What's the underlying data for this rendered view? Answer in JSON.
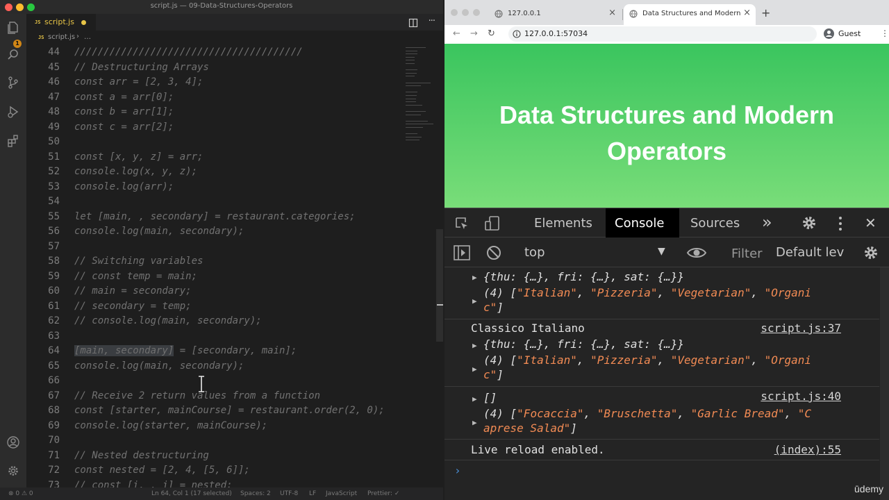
{
  "vscode": {
    "window_title": "script.js — 09-Data-Structures-Operators",
    "tab_label": "script.js",
    "file_badge": "JS",
    "breadcrumb_file": "script.js",
    "breadcrumb_sep": "›",
    "breadcrumb_more": "…",
    "source_control_badge": "1",
    "more_actions": "···",
    "lines": [
      {
        "n": "44",
        "code": "///////////////////////////////////////"
      },
      {
        "n": "45",
        "code": "// Destructuring Arrays"
      },
      {
        "n": "46",
        "code": "const arr = [2, 3, 4];"
      },
      {
        "n": "47",
        "code": "const a = arr[0];"
      },
      {
        "n": "48",
        "code": "const b = arr[1];"
      },
      {
        "n": "49",
        "code": "const c = arr[2];"
      },
      {
        "n": "50",
        "code": ""
      },
      {
        "n": "51",
        "code": "const [x, y, z] = arr;"
      },
      {
        "n": "52",
        "code": "console.log(x, y, z);"
      },
      {
        "n": "53",
        "code": "console.log(arr);"
      },
      {
        "n": "54",
        "code": ""
      },
      {
        "n": "55",
        "code": "let [main, , secondary] = restaurant.categories;"
      },
      {
        "n": "56",
        "code": "console.log(main, secondary);"
      },
      {
        "n": "57",
        "code": ""
      },
      {
        "n": "58",
        "code": "// Switching variables"
      },
      {
        "n": "59",
        "code": "// const temp = main;"
      },
      {
        "n": "60",
        "code": "// main = secondary;"
      },
      {
        "n": "61",
        "code": "// secondary = temp;"
      },
      {
        "n": "62",
        "code": "// console.log(main, secondary);"
      },
      {
        "n": "63",
        "code": ""
      },
      {
        "n": "64",
        "sel": "[main, secondary]",
        "rest": " = [secondary, main];"
      },
      {
        "n": "65",
        "code": "console.log(main, secondary);"
      },
      {
        "n": "66",
        "code": ""
      },
      {
        "n": "67",
        "code": "// Receive 2 return values from a function"
      },
      {
        "n": "68",
        "code": "const [starter, mainCourse] = restaurant.order(2, 0);"
      },
      {
        "n": "69",
        "code": "console.log(starter, mainCourse);"
      },
      {
        "n": "70",
        "code": ""
      },
      {
        "n": "71",
        "code": "// Nested destructuring"
      },
      {
        "n": "72",
        "code": "const nested = [2, 4, [5, 6]];"
      },
      {
        "n": "73",
        "code": "// const [i, , j] = nested;"
      }
    ],
    "status": {
      "problems": "⊗ 0 ⚠ 0",
      "position": "Ln 64, Col 1 (17 selected)",
      "spaces": "Spaces: 2",
      "encoding": "UTF-8",
      "eol": "LF",
      "language": "JavaScript",
      "prettier": "Prettier: ✓"
    }
  },
  "chrome": {
    "tabs": [
      {
        "label": "127.0.0.1",
        "close": "×"
      },
      {
        "label": "Data Structures and Modern Operators",
        "close": "×"
      }
    ],
    "new_tab": "+",
    "back": "←",
    "forward": "→",
    "reload": "↻",
    "url": "127.0.0.1:57034",
    "profile_label": "Guest",
    "menu": "⋮",
    "page_title_line1": "Data Structures and Modern",
    "page_title_line2": "Operators"
  },
  "devtools": {
    "tabs": [
      "Elements",
      "Console",
      "Sources"
    ],
    "overflow": "»",
    "close": "✕",
    "context": "top",
    "context_caret": "▼",
    "filter_placeholder": "Filter",
    "levels": "Default levels",
    "messages": {
      "m1": "{thu: {…}, fri: {…}, sat: {…}}",
      "m2_count": "(4) [",
      "m2_a": "\"Italian\"",
      "m2_b": "\"Pizzeria\"",
      "m2_c": "\"Vegetarian\"",
      "m2_d1": "\"Organi",
      "m2_d2": "c\"",
      "m2_end": "]",
      "m3": "Classico Italiano",
      "m3_src": "script.js:37",
      "m4": "{thu: {…}, fri: {…}, sat: {…}}",
      "m5_count": "(4) [",
      "m5_a": "\"Italian\"",
      "m5_b": "\"Pizzeria\"",
      "m5_c": "\"Vegetarian\"",
      "m5_d1": "\"Organi",
      "m5_d2": "c\"",
      "m5_end": "]",
      "m6": "[]",
      "m6_src": "script.js:40",
      "m7_count": "(4) [",
      "m7_a": "\"Focaccia\"",
      "m7_b": "\"Bruschetta\"",
      "m7_c": "\"Garlic Bread\"",
      "m7_d1": "\"C",
      "m7_d2": "aprese Salad\"",
      "m7_end": "]",
      "m8": "Live reload enabled.",
      "m8_src": "(index):55"
    },
    "prompt": "›",
    "watermark": "ūdemy"
  }
}
